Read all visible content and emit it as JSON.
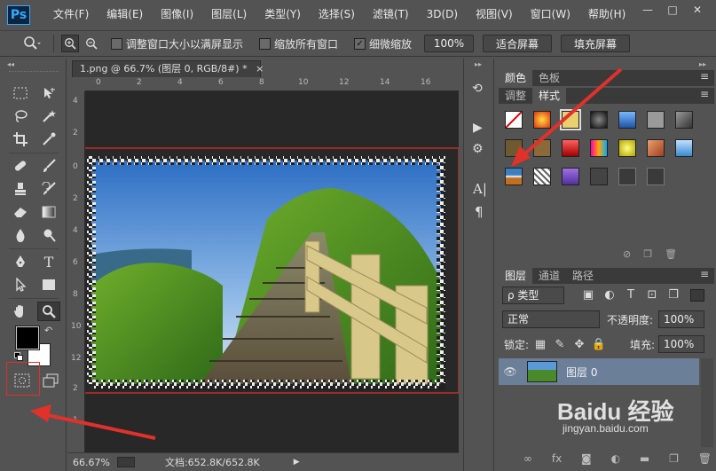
{
  "app": {
    "logo": "Ps"
  },
  "menus": [
    "文件(F)",
    "编辑(E)",
    "图像(I)",
    "图层(L)",
    "类型(Y)",
    "选择(S)",
    "滤镜(T)",
    "3D(D)",
    "视图(V)",
    "窗口(W)",
    "帮助(H)"
  ],
  "window_controls": {
    "minimize": "—",
    "maximize": "□",
    "close": "✕"
  },
  "options": {
    "fit_window_label": "调整窗口大小以满屏显示",
    "zoom_all_label": "缩放所有窗口",
    "scrubby_label": "细微缩放",
    "zoom_value": "100%",
    "fit_screen": "适合屏幕",
    "fill_screen": "填充屏幕"
  },
  "document": {
    "tab_title": "1.png @ 66.7% (图层 0, RGB/8#) *",
    "close_glyph": "×",
    "ruler_top_ticks": [
      "0",
      "2",
      "4",
      "6",
      "8",
      "10",
      "12",
      "14",
      "16"
    ],
    "ruler_left_ticks": [
      "4",
      "2",
      "0",
      "2",
      "4",
      "6",
      "8",
      "10",
      "12",
      "2",
      "1"
    ]
  },
  "status": {
    "zoom": "66.67%",
    "doc_size": "文档:652.8K/652.8K",
    "arrow": "▶"
  },
  "panels": {
    "color_tabs": [
      "颜色",
      "色板"
    ],
    "style_tabs": [
      "调整",
      "样式"
    ],
    "layer_tabs": [
      "图层",
      "通道",
      "路径"
    ],
    "filter_kind": "ρ 类型",
    "blend_mode": "正常",
    "opacity_label": "不透明度:",
    "opacity_value": "100%",
    "lock_label": "锁定:",
    "fill_label": "填充:",
    "fill_value": "100%",
    "layer_name": "图层 0"
  },
  "style_swatch_colors": [
    "#ffffff",
    "#ff5a1a",
    "#e8d070",
    "#333333",
    "#1f74c4",
    "#9a9a9a",
    "#6e6e6e",
    "#6e5a30",
    "#8a6a3a",
    "#d02020",
    "#e05aa0",
    "#e8e800",
    "#d08050",
    "#6aaae0",
    "#3a80c0",
    "#bbbbbb",
    "#9050c0",
    "#444444",
    "#3a3a3a",
    "#3a3a3a"
  ],
  "watermark": "Baidu 经验",
  "watermark_url": "jingyan.baidu.com",
  "colors": {
    "annot_red": "#e0312a",
    "foreground": "#000000",
    "background": "#ffffff"
  }
}
